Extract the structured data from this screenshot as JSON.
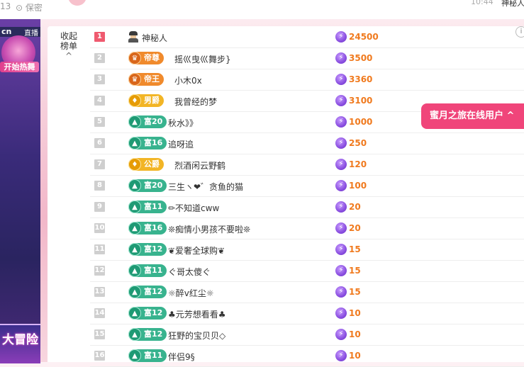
{
  "topbar": {
    "count": "13",
    "location": "保密",
    "time": "10:44",
    "username": "神秘人"
  },
  "left_panel": {
    "recommend_left": "cn",
    "recommend_right": "直播",
    "live_button": "开始热舞",
    "adventure_label": "大冒险"
  },
  "collapse": {
    "line1": "收起",
    "line2": "榜单",
    "chevron": "^"
  },
  "online_button": {
    "label": "蜜月之旅在线用户",
    "chevron": "^"
  },
  "rows": [
    {
      "rank": "1",
      "badge_type": "spy",
      "badge": "",
      "badge_icon": "",
      "name": "神秘人",
      "amount": "24500"
    },
    {
      "rank": "2",
      "badge_type": "emperor",
      "badge": "帝尊",
      "badge_icon": "♛",
      "name": "摇巛曳巛舞步}",
      "amount": "3500"
    },
    {
      "rank": "3",
      "badge_type": "emperor",
      "badge": "帝王",
      "badge_icon": "♛",
      "name": "小木0x",
      "amount": "3360"
    },
    {
      "rank": "4",
      "badge_type": "noble",
      "badge": "男爵",
      "badge_icon": "♦",
      "name": "我曾经的梦",
      "amount": "3100"
    },
    {
      "rank": "5",
      "badge_type": "rich",
      "badge": "富20",
      "badge_icon": "▲",
      "name": "秋水》》",
      "amount": "1000"
    },
    {
      "rank": "6",
      "badge_type": "rich",
      "badge": "富16",
      "badge_icon": "▲",
      "name": "追呀追",
      "amount": "250"
    },
    {
      "rank": "7",
      "badge_type": "noble",
      "badge": "公爵",
      "badge_icon": "♦",
      "name": "烈酒闲云野鹤",
      "amount": "120"
    },
    {
      "rank": "8",
      "badge_type": "rich",
      "badge": "富20",
      "badge_icon": "▲",
      "name": "三生ヽ❤゛贪鱼的猫",
      "amount": "100"
    },
    {
      "rank": "9",
      "badge_type": "rich",
      "badge": "富11",
      "badge_icon": "▲",
      "name": "✏不知道cww",
      "amount": "20"
    },
    {
      "rank": "10",
      "badge_type": "rich",
      "badge": "富16",
      "badge_icon": "▲",
      "name": "❊痴情小男孩不要啦❊",
      "amount": "20"
    },
    {
      "rank": "11",
      "badge_type": "rich",
      "badge": "富12",
      "badge_icon": "▲",
      "name": "❦爱奢全球购❦",
      "amount": "15"
    },
    {
      "rank": "12",
      "badge_type": "rich",
      "badge": "富11",
      "badge_icon": "▲",
      "name": "ぐ哥太傻ぐ",
      "amount": "15"
    },
    {
      "rank": "13",
      "badge_type": "rich",
      "badge": "富12",
      "badge_icon": "▲",
      "name": "☼醉v红尘☼",
      "amount": "15"
    },
    {
      "rank": "14",
      "badge_type": "rich",
      "badge": "富12",
      "badge_icon": "▲",
      "name": "♣元芳想看看♣",
      "amount": "10"
    },
    {
      "rank": "15",
      "badge_type": "rich",
      "badge": "富12",
      "badge_icon": "▲",
      "name": "狂野的宝贝贝◇",
      "amount": "10"
    },
    {
      "rank": "16",
      "badge_type": "rich",
      "badge": "富11",
      "badge_icon": "▲",
      "name": "伴侣9§",
      "amount": "10"
    }
  ],
  "coin_icon": "⚡",
  "colors": {
    "accent": "#f0457a",
    "amount": "#f07a1e",
    "rank_top": "#ef5a6f",
    "rich_badge": "#38b38e",
    "emperor_badge": "#f08a2c",
    "noble_badge": "#f2b525"
  }
}
